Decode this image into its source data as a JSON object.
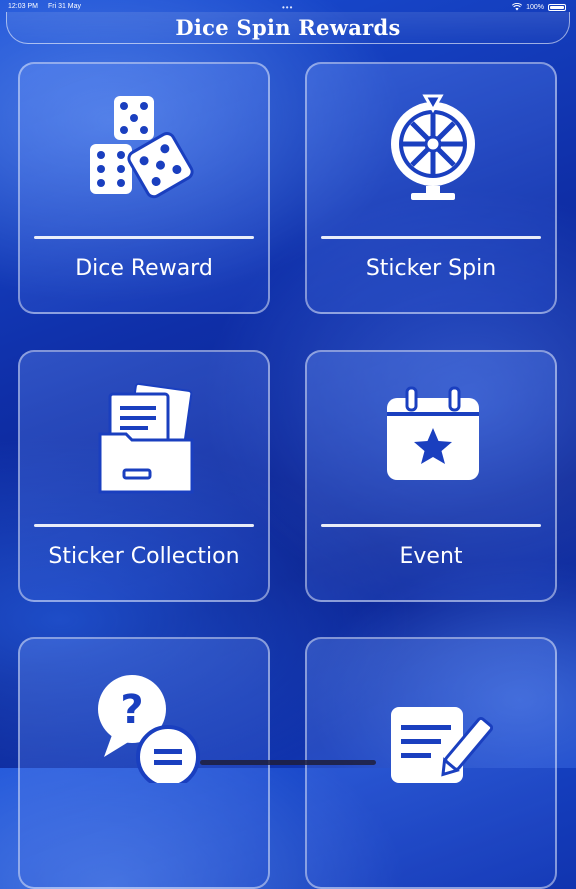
{
  "status_bar": {
    "time": "12:03 PM",
    "date": "Fri 31 May",
    "battery": "100%",
    "dots": "•••"
  },
  "header": {
    "title": "Dice Spin Rewards"
  },
  "cards": [
    {
      "label": "Dice Reward",
      "icon": "dice-icon"
    },
    {
      "label": "Sticker Spin",
      "icon": "prize-wheel-icon"
    },
    {
      "label": "Sticker Collection",
      "icon": "folder-documents-icon"
    },
    {
      "label": "Event",
      "icon": "calendar-star-icon"
    },
    {
      "label": "",
      "icon": "faq-chat-icon"
    },
    {
      "label": "",
      "icon": "notes-edit-icon"
    }
  ]
}
